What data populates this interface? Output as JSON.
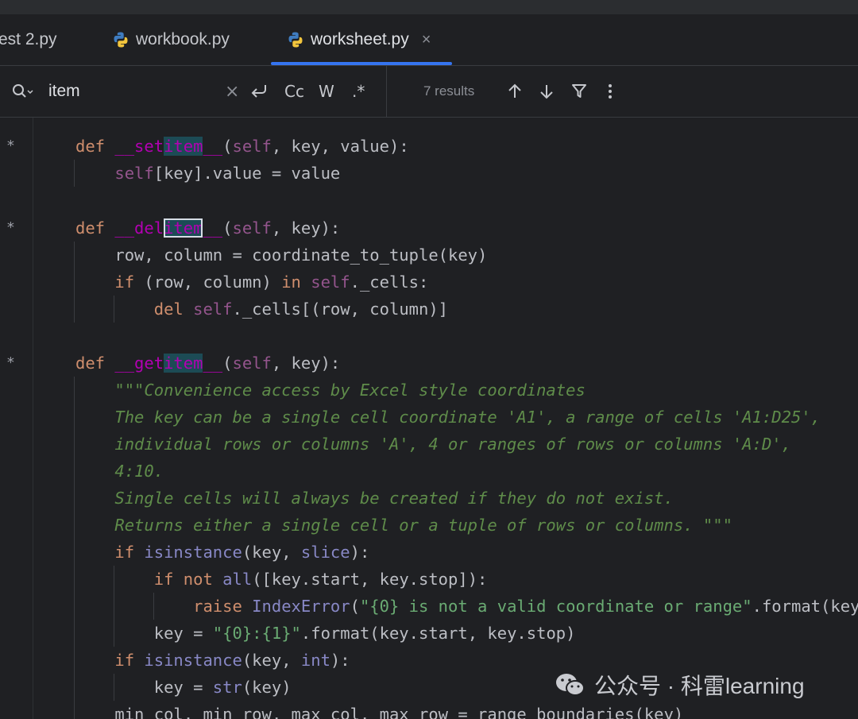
{
  "tabs": [
    {
      "label": "est 2.py",
      "icon": "python-icon"
    },
    {
      "label": "workbook.py",
      "icon": "python-icon"
    },
    {
      "label": "worksheet.py",
      "icon": "python-icon",
      "active": true,
      "close": "×"
    }
  ],
  "find": {
    "query": "item",
    "clear": "×",
    "options": {
      "case": "Cc",
      "words": "W",
      "regex": ".*"
    },
    "results": "7 results"
  },
  "code": {
    "markers": [
      "*",
      "*",
      "*"
    ]
  },
  "watermark": {
    "text": "公众号 · 科雷learning"
  },
  "colors": {
    "accent": "#3574f0",
    "match": "#1c4b55",
    "keyword": "#cf8e6d",
    "dunder": "#b200b2",
    "string": "#6aab73"
  }
}
